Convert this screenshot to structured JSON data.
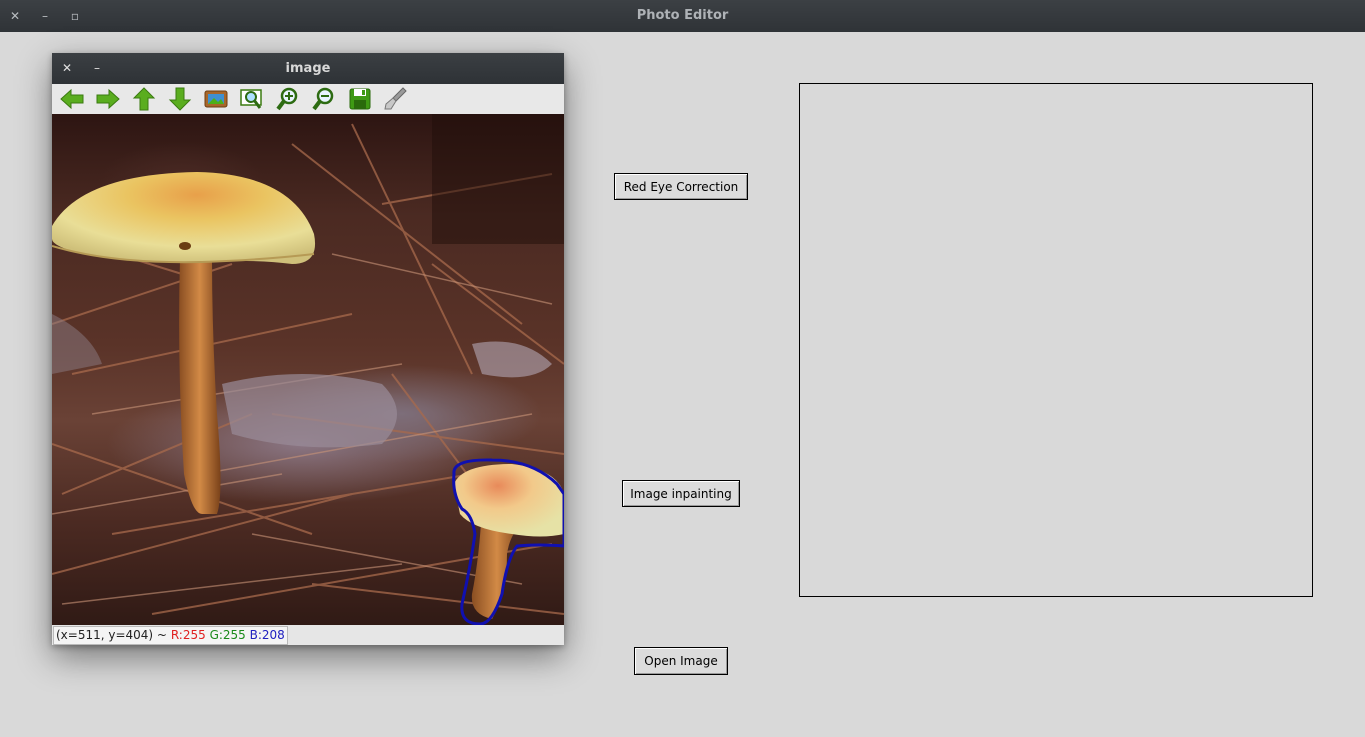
{
  "window": {
    "title": "Photo Editor",
    "controls": {
      "close": "✕",
      "minimize": "–",
      "maximize": "▫"
    }
  },
  "image_window": {
    "title": "image",
    "controls": {
      "close": "✕",
      "minimize": "–"
    },
    "toolbar": [
      {
        "name": "pan-left-icon"
      },
      {
        "name": "pan-right-icon"
      },
      {
        "name": "pan-up-icon"
      },
      {
        "name": "pan-down-icon"
      },
      {
        "name": "fit-image-icon"
      },
      {
        "name": "zoom-region-icon"
      },
      {
        "name": "zoom-in-icon"
      },
      {
        "name": "zoom-out-icon"
      },
      {
        "name": "save-icon"
      },
      {
        "name": "properties-icon"
      }
    ],
    "status": {
      "coords": "(x=511, y=404) ~",
      "r": "R:255",
      "g": "G:255",
      "b": "B:208"
    }
  },
  "buttons": {
    "red_eye": "Red Eye Correction",
    "inpainting": "Image inpainting",
    "open_image": "Open Image"
  },
  "colors": {
    "status_r": "#e02020",
    "status_g": "#1a8a1a",
    "status_b": "#2020c0",
    "selection_outline": "#1010b0",
    "toolbar_green": "#4caf1a"
  }
}
